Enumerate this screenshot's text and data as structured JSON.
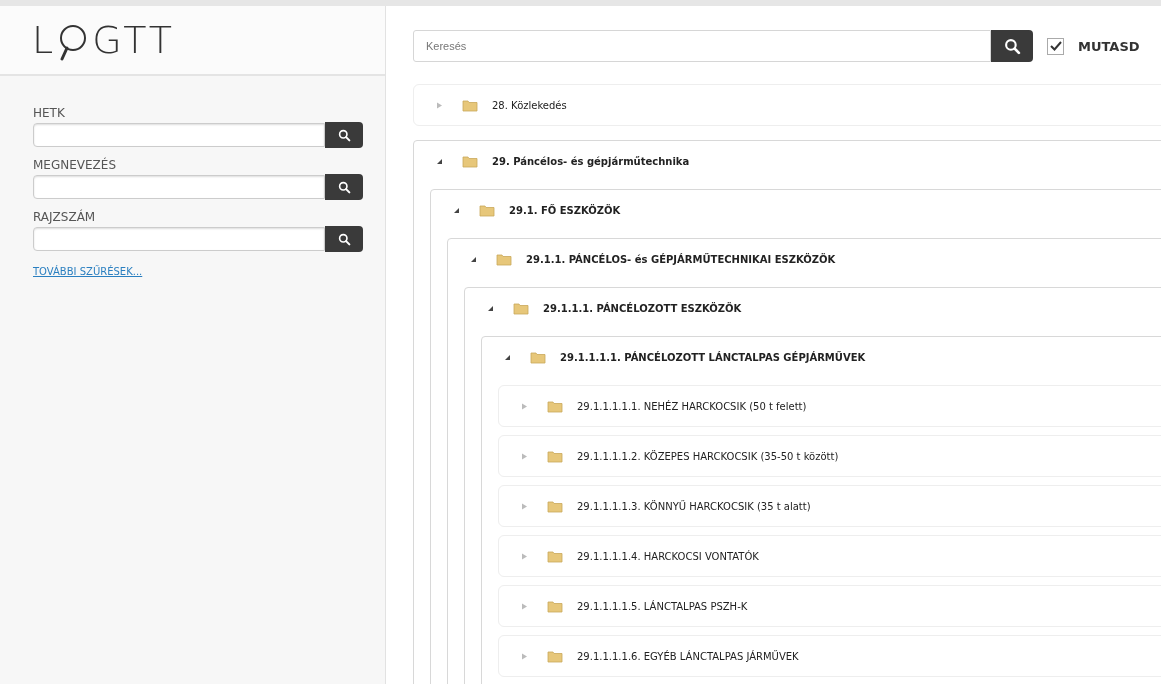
{
  "logo": {
    "before": "L",
    "after": "GTT"
  },
  "filters": [
    {
      "label": "HETK"
    },
    {
      "label": "MEGNEVEZÉS"
    },
    {
      "label": "RAJZSZÁM"
    }
  ],
  "more_filters_link": "TOVÁBBI SZŰRÉSEK...",
  "search": {
    "placeholder": "Keresés"
  },
  "show_option": {
    "label": "MUTASD",
    "checked": true
  },
  "tree": [
    {
      "label": "28. Közlekedés",
      "expanded": false
    },
    {
      "label": "29. Páncélos- és gépjárműtechnika",
      "expanded": true,
      "children": [
        {
          "label": "29.1. FŐ ESZKÖZÖK",
          "expanded": true,
          "children": [
            {
              "label": "29.1.1. PÁNCÉLOS- és GÉPJÁRMŰTECHNIKAI ESZKÖZÖK",
              "expanded": true,
              "children": [
                {
                  "label": "29.1.1.1. PÁNCÉLOZOTT ESZKÖZÖK",
                  "expanded": true,
                  "children": [
                    {
                      "label": "29.1.1.1.1. PÁNCÉLOZOTT LÁNCTALPAS GÉPJÁRMŰVEK",
                      "expanded": true,
                      "children": [
                        {
                          "label": "29.1.1.1.1.1. NEHÉZ HARCKOCSIK (50 t felett)",
                          "expanded": false
                        },
                        {
                          "label": "29.1.1.1.1.2. KÖZEPES HARCKOCSIK (35-50 t között)",
                          "expanded": false
                        },
                        {
                          "label": "29.1.1.1.1.3. KÖNNYŰ HARCKOCSIK (35 t alatt)",
                          "expanded": false
                        },
                        {
                          "label": "29.1.1.1.1.4. HARCKOCSI VONTATÓK",
                          "expanded": false
                        },
                        {
                          "label": "29.1.1.1.1.5. LÁNCTALPAS PSZH-K",
                          "expanded": false
                        },
                        {
                          "label": "29.1.1.1.1.6. EGYÉB LÁNCTALPAS JÁRMŰVEK",
                          "expanded": false
                        }
                      ]
                    }
                  ]
                }
              ]
            }
          ]
        }
      ]
    }
  ]
}
